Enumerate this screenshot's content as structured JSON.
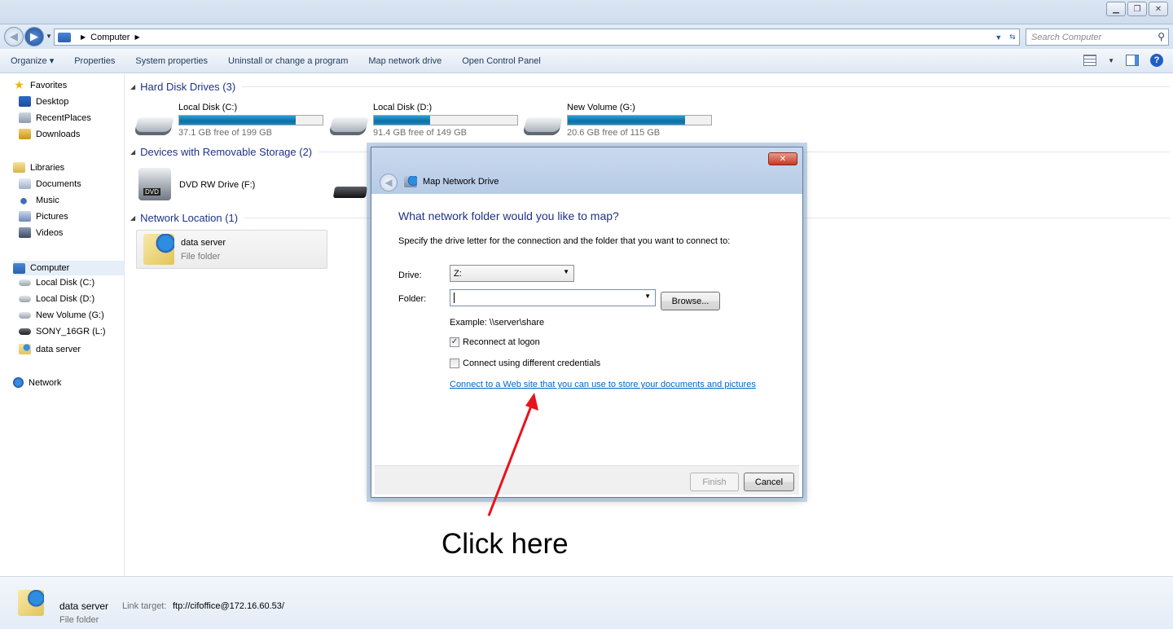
{
  "window": {
    "controls": [
      "minimize-icon",
      "restore-icon",
      "close-icon"
    ]
  },
  "address": {
    "path": [
      "Computer"
    ],
    "search_placeholder": "Search Computer"
  },
  "toolbar": {
    "organize": "Organize ▾",
    "properties": "Properties",
    "system_properties": "System properties",
    "uninstall": "Uninstall or change a program",
    "map_drive": "Map network drive",
    "control_panel": "Open Control Panel"
  },
  "sidebar": {
    "favorites": "Favorites",
    "desktop": "Desktop",
    "recent": "RecentPlaces",
    "downloads": "Downloads",
    "libraries": "Libraries",
    "documents": "Documents",
    "music": "Music",
    "pictures": "Pictures",
    "videos": "Videos",
    "computer": "Computer",
    "disk_c": "Local Disk (C:)",
    "disk_d": "Local Disk (D:)",
    "vol_g": "New Volume (G:)",
    "sony": "SONY_16GR (L:)",
    "data_server": "data server",
    "network": "Network"
  },
  "content": {
    "hdd_group": "Hard Disk Drives (3)",
    "removable_group": "Devices with Removable Storage (2)",
    "network_group": "Network Location (1)",
    "drives": [
      {
        "name": "Local Disk (C:)",
        "free": "37.1 GB free of 199 GB",
        "used_fraction": 0.81
      },
      {
        "name": "Local Disk (D:)",
        "free": "91.4 GB free of 149 GB",
        "used_fraction": 0.39
      },
      {
        "name": "New Volume (G:)",
        "free": "20.6 GB free of 115 GB",
        "used_fraction": 0.82
      }
    ],
    "dvd": "DVD RW Drive (F:)",
    "dvd_badge": "DVD",
    "net_location": {
      "name": "data server",
      "type": "File folder"
    }
  },
  "dialog": {
    "title": "Map Network Drive",
    "close": "✕",
    "heading": "What network folder would you like to map?",
    "description": "Specify the drive letter for the connection and the folder that you want to connect to:",
    "drive_label": "Drive:",
    "drive_value": "Z:",
    "folder_label": "Folder:",
    "folder_value": "",
    "browse": "Browse...",
    "example": "Example: \\\\server\\share",
    "reconnect": "Reconnect at logon",
    "reconnect_checked": true,
    "credentials": "Connect using different credentials",
    "credentials_checked": false,
    "link": "Connect to a Web site that you can use to store your documents and pictures",
    "finish": "Finish",
    "cancel": "Cancel"
  },
  "annotation": {
    "text": "Click here",
    "color": "#e8131b"
  },
  "details": {
    "name": "data server",
    "target_label": "Link target:",
    "target_value": "ftp://cifoffice@172.16.60.53/",
    "type": "File folder"
  }
}
